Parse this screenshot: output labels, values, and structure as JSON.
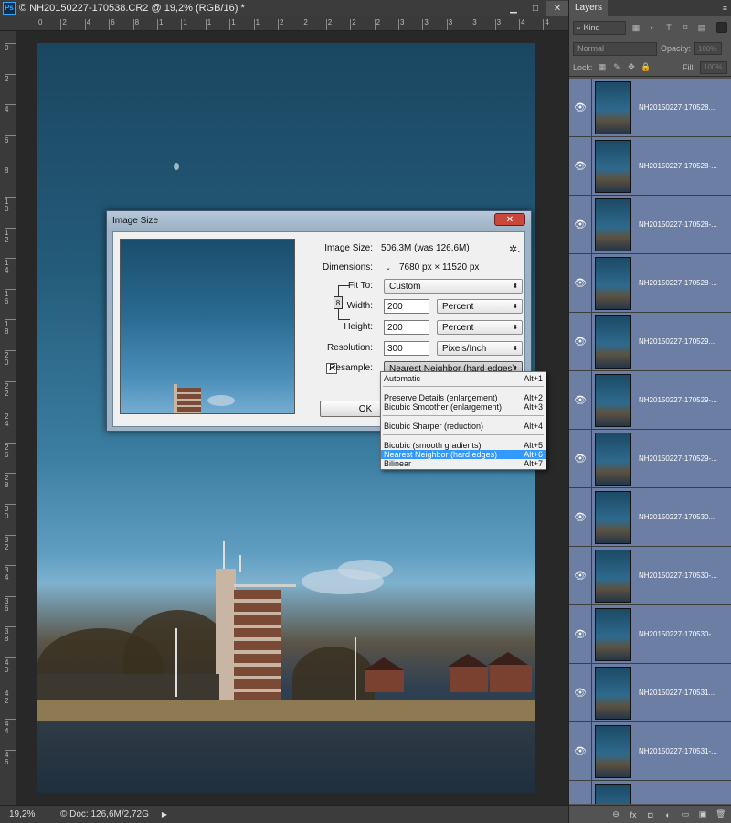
{
  "window": {
    "title": "© NH20150227-170538.CR2 @ 19,2% (RGB/16) *",
    "logo": "Ps",
    "minimize_icon": "▁",
    "maximize_icon": "□",
    "close_icon": "✕"
  },
  "rulers": {
    "top_labels": [
      "0",
      "2",
      "4",
      "6",
      "8",
      "1",
      "1",
      "1",
      "1",
      "1",
      "2",
      "2",
      "2",
      "2",
      "2",
      "3",
      "3",
      "3",
      "3",
      "3",
      "4",
      "4"
    ],
    "left_labels": [
      "0",
      "2",
      "4",
      "6",
      "8",
      "1\n0",
      "1\n2",
      "1\n4",
      "1\n6",
      "1\n8",
      "2\n0",
      "2\n2",
      "2\n4",
      "2\n6",
      "2\n8",
      "3\n0",
      "3\n2",
      "3\n4",
      "3\n6",
      "3\n8",
      "4\n0",
      "4\n2",
      "4\n4",
      "4\n6"
    ]
  },
  "status": {
    "zoom": "19,2%",
    "doc": "© Doc: 126,6M/2,72G",
    "arrow_icon": "▶"
  },
  "layers_panel": {
    "tab": "Layers",
    "menu_icon": "≡",
    "kind_label": "Kind",
    "blend_mode": "Normal",
    "opacity_label": "Opacity:",
    "opacity_value": "100%",
    "lock_label": "Lock:",
    "fill_label": "Fill:",
    "fill_value": "100%",
    "layers": [
      {
        "name": "NH20150227-170528..."
      },
      {
        "name": "NH20150227-170528-..."
      },
      {
        "name": "NH20150227-170528-..."
      },
      {
        "name": "NH20150227-170528-..."
      },
      {
        "name": "NH20150227-170529..."
      },
      {
        "name": "NH20150227-170529-..."
      },
      {
        "name": "NH20150227-170529-..."
      },
      {
        "name": "NH20150227-170530..."
      },
      {
        "name": "NH20150227-170530-..."
      },
      {
        "name": "NH20150227-170530-..."
      },
      {
        "name": "NH20150227-170531..."
      },
      {
        "name": "NH20150227-170531-..."
      },
      {
        "name": ""
      }
    ],
    "bottom_icons": [
      "link-icon",
      "fx-icon",
      "mask-icon",
      "adjustment-icon",
      "group-icon",
      "new-layer-icon",
      "trash-icon"
    ],
    "bottom_glyphs": [
      "⊖",
      "fx",
      "◘",
      "◐",
      "▭",
      "▣",
      "🗑"
    ]
  },
  "dialog": {
    "title": "Image Size",
    "close": "✕",
    "image_size_label": "Image Size:",
    "image_size_value": "506,3M (was 126,6M)",
    "gear": "✲.",
    "dimensions_label": "Dimensions:",
    "dimensions_value": "7680 px  ×  11520 px",
    "fit_to_label": "Fit To:",
    "fit_to_value": "Custom",
    "width_label": "Width:",
    "width_value": "200",
    "width_unit": "Percent",
    "height_label": "Height:",
    "height_value": "200",
    "height_unit": "Percent",
    "resolution_label": "Resolution:",
    "resolution_value": "300",
    "resolution_unit": "Pixels/Inch",
    "resample_label": "Resample:",
    "resample_checked": "✓",
    "resample_value": "Nearest Neighbor (hard edges)",
    "ok_label": "OK",
    "dd_arrow": "⬍"
  },
  "resample_menu": [
    {
      "label": "Automatic",
      "shortcut": "Alt+1"
    },
    {
      "label": "Preserve Details (enlargement)",
      "shortcut": "Alt+2"
    },
    {
      "label": "Bicubic Smoother (enlargement)",
      "shortcut": "Alt+3"
    },
    {
      "label": "Bicubic Sharper (reduction)",
      "shortcut": "Alt+4"
    },
    {
      "label": "Bicubic (smooth gradients)",
      "shortcut": "Alt+5"
    },
    {
      "label": "Nearest Neighbor (hard edges)",
      "shortcut": "Alt+6",
      "selected": true
    },
    {
      "label": "Bilinear",
      "shortcut": "Alt+7"
    }
  ],
  "colors": {
    "selection": "#3399ff",
    "layer_row": "#6c7ea3",
    "panel": "#535353"
  }
}
